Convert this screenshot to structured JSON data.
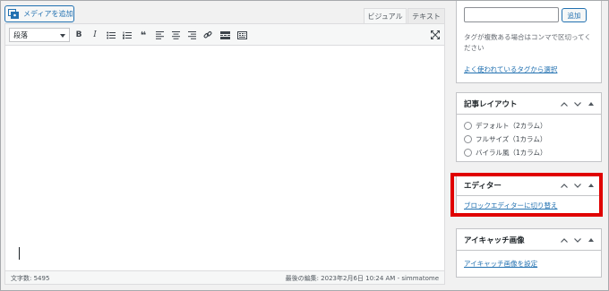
{
  "toolbar_top": {
    "media_button": "メディアを追加",
    "tabs": [
      "ビジュアル",
      "テキスト"
    ]
  },
  "editor": {
    "format_select": "段落",
    "buttons": [
      "B",
      "I",
      "❝"
    ],
    "word_count": "文字数: 5495",
    "last_edited": "最後の編集: 2023年2月6日 10:24 AM - simmatome"
  },
  "tags": {
    "input_value": "",
    "add_button": "追加",
    "help": "タグが複数ある場合はコンマで区切ってください",
    "frequent_link": "よく使われているタグから選択"
  },
  "layout_box": {
    "title": "記事レイアウト",
    "options": [
      "デフォルト（2カラム）",
      "フルサイズ（1カラム）",
      "バイラル風（1カラム）"
    ]
  },
  "editor_box": {
    "title": "エディター",
    "link": "ブロックエディターに切り替え"
  },
  "featured_box": {
    "title": "アイキャッチ画像",
    "link": "アイキャッチ画像を設定"
  },
  "colors": {
    "accent": "#2271b1",
    "highlight": "#e00000"
  }
}
